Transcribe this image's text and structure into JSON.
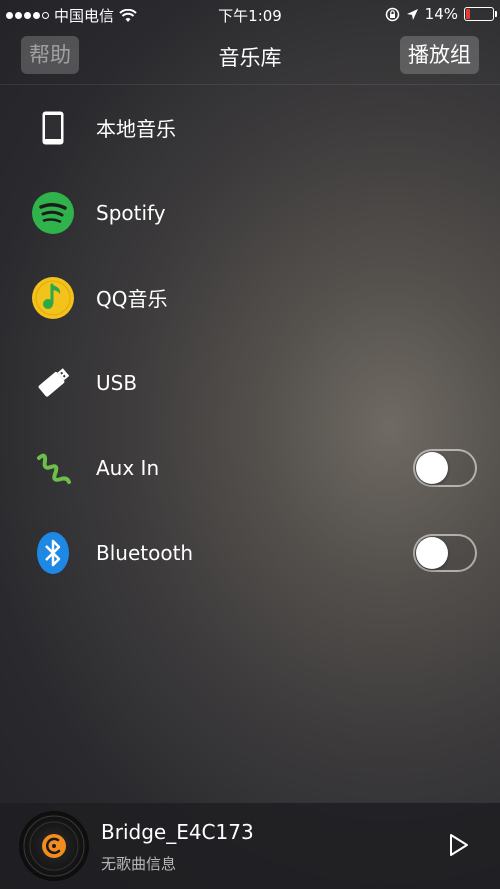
{
  "status_bar": {
    "carrier": "中国电信",
    "time": "下午1:09",
    "battery": "14%"
  },
  "nav": {
    "help_label": "帮助",
    "title": "音乐库",
    "group_label": "播放组"
  },
  "sources": [
    {
      "label": "本地音乐",
      "icon": "phone-icon"
    },
    {
      "label": "Spotify",
      "icon": "spotify-icon"
    },
    {
      "label": "QQ音乐",
      "icon": "qq-music-icon"
    },
    {
      "label": "USB",
      "icon": "usb-icon"
    },
    {
      "label": "Aux In",
      "icon": "aux-in-icon",
      "toggle": false
    },
    {
      "label": "Bluetooth",
      "icon": "bluetooth-icon",
      "toggle": false
    }
  ],
  "player": {
    "device_name": "Bridge_E4C173",
    "song_info": "无歌曲信息"
  },
  "colors": {
    "spotify": "#2fb34a",
    "qq_music": "#f3c21b",
    "aux": "#6cc04a",
    "bluetooth": "#1e88e5",
    "battery_low": "#e53935"
  }
}
